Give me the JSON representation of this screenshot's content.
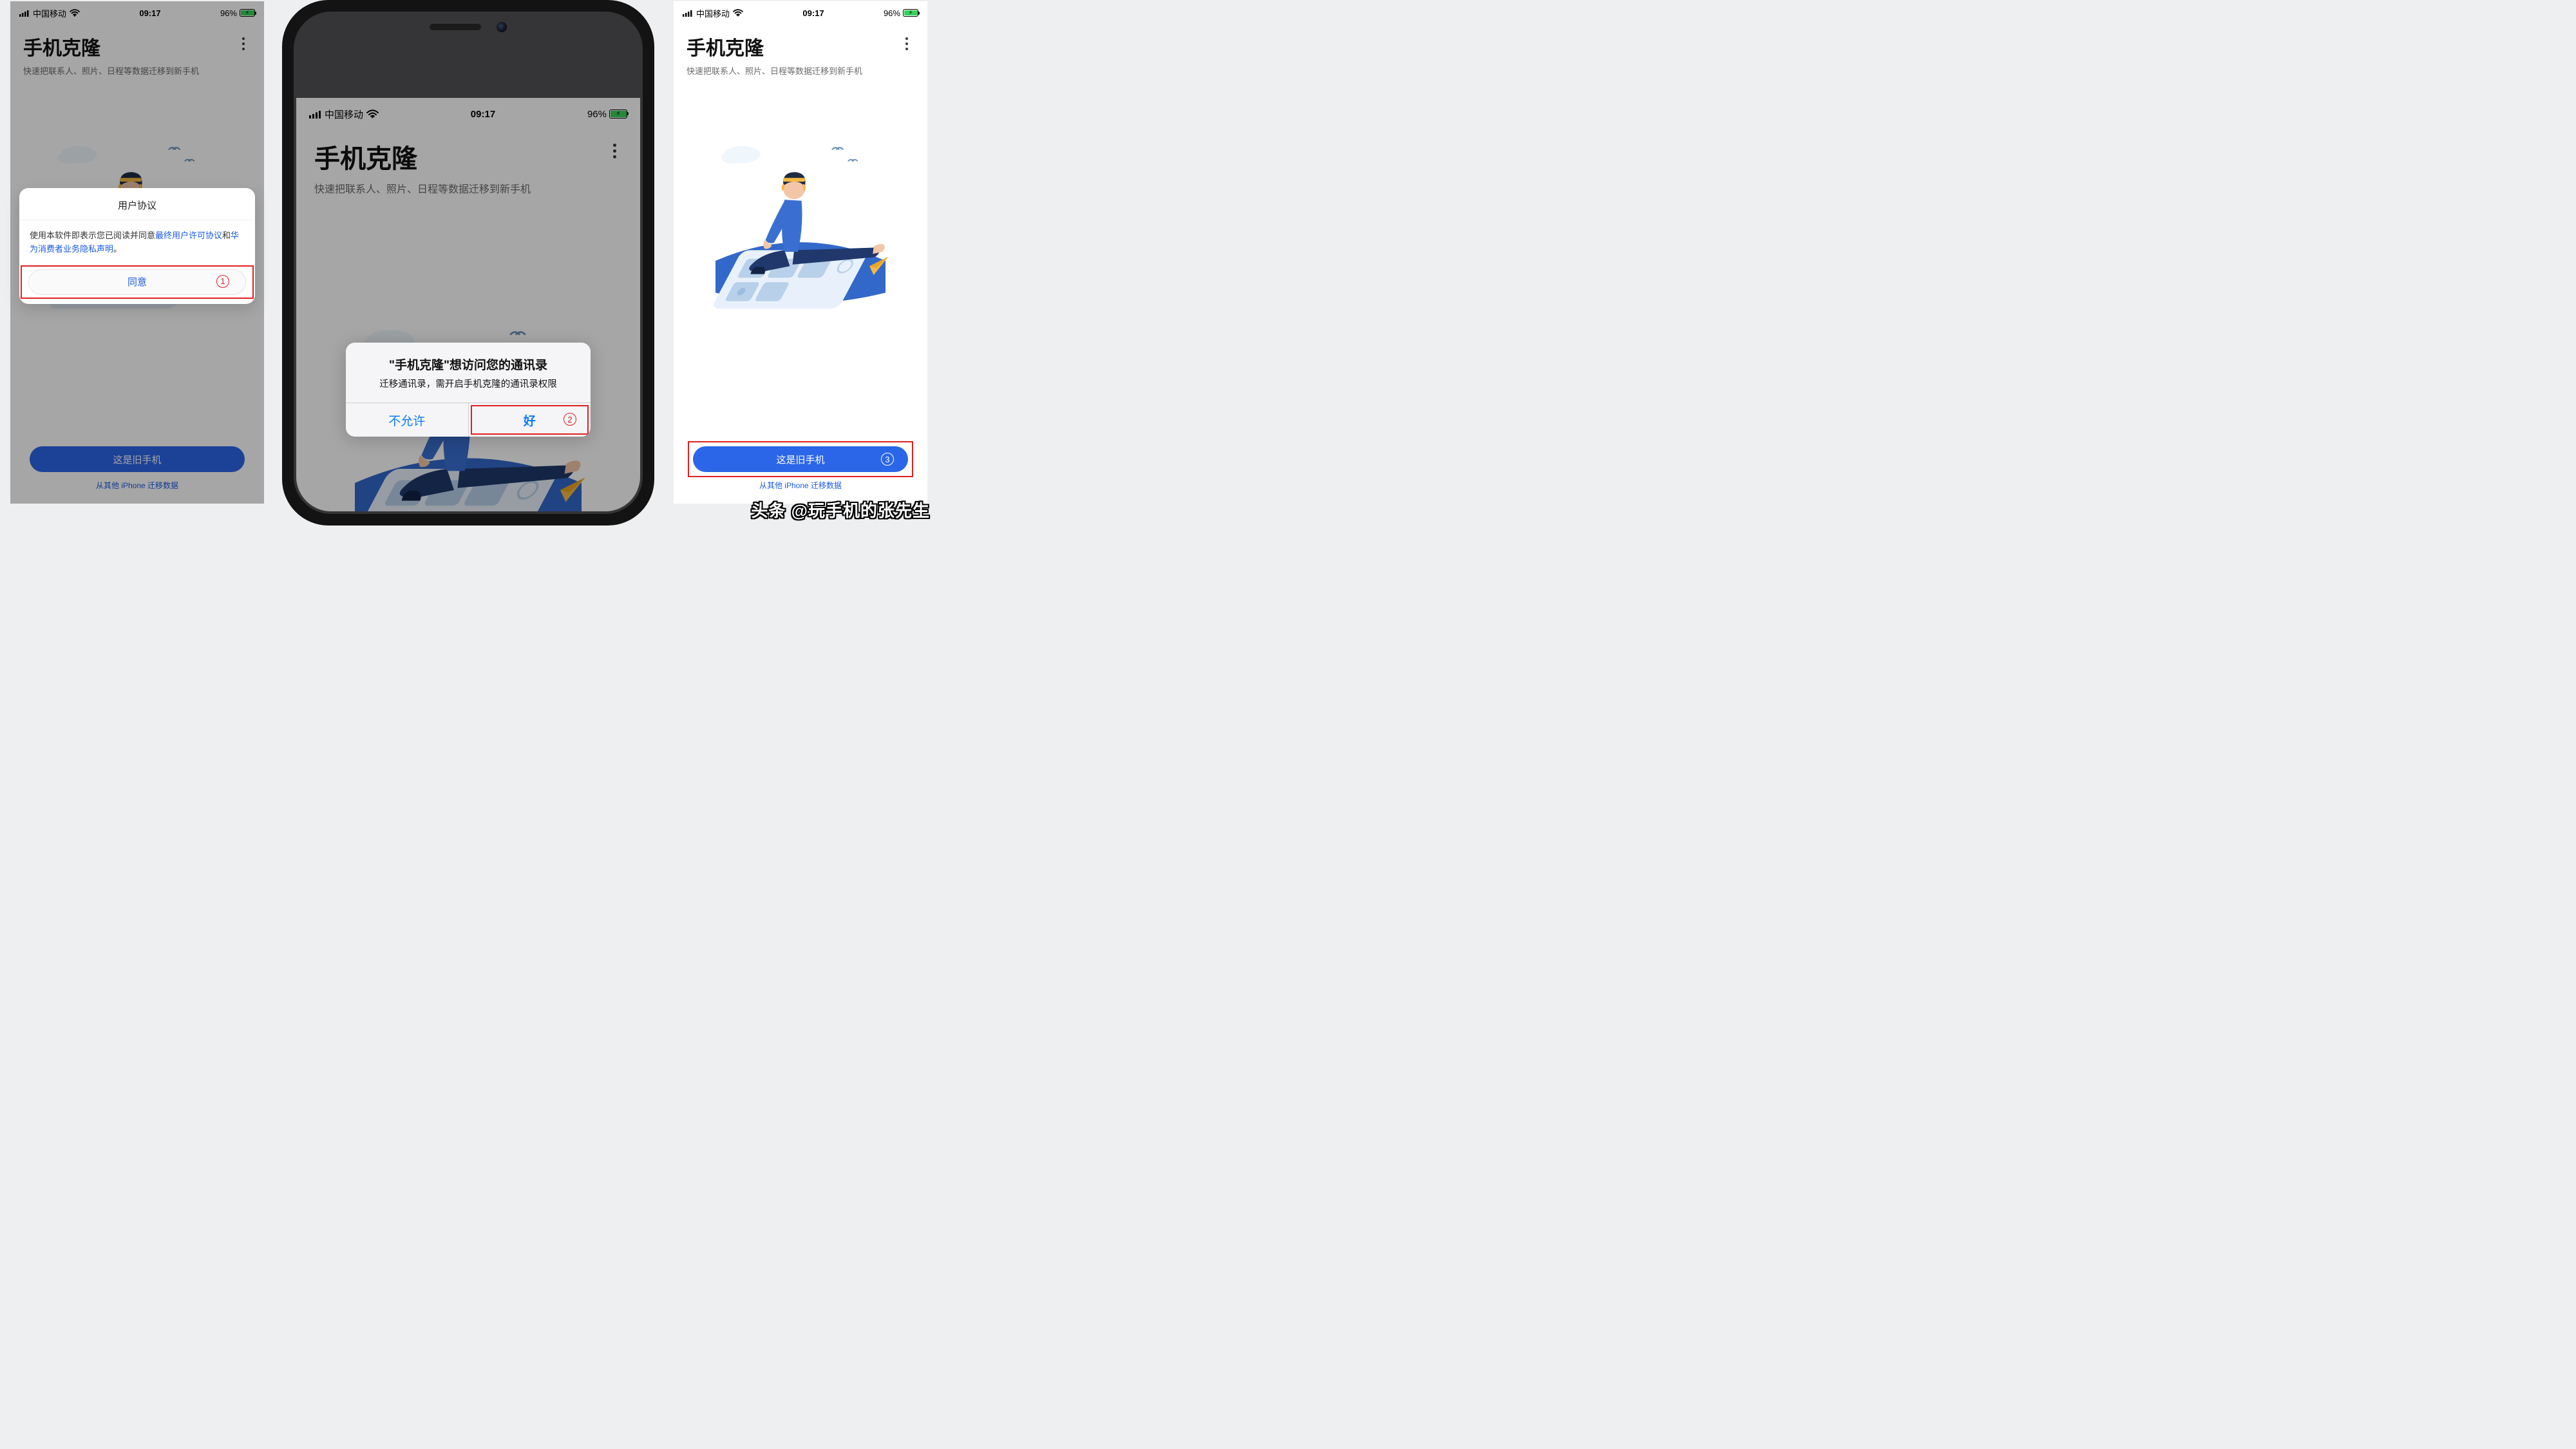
{
  "status": {
    "carrier": "中国移动",
    "time": "09:17",
    "battery_pct": "96%"
  },
  "header": {
    "title": "手机克隆",
    "subtitle": "快速把联系人、照片、日程等数据迁移到新手机"
  },
  "bottom": {
    "primary": "这是旧手机",
    "link": "从其他 iPhone 迁移数据"
  },
  "panel1": {
    "sheet_title": "用户协议",
    "sheet_text_1": "使用本软件即表示您已阅读并同意",
    "sheet_link_1": "最终用户许可协议",
    "sheet_text_2": "和",
    "sheet_link_2": "华为消费者业务隐私声明",
    "sheet_text_3": "。",
    "agree": "同意",
    "anno": "1"
  },
  "panel2": {
    "alert_title": "\"手机克隆\"想访问您的通讯录",
    "alert_msg": "迁移通讯录，需开启手机克隆的通讯录权限",
    "deny": "不允许",
    "allow": "好",
    "anno": "2"
  },
  "panel3": {
    "anno": "3"
  },
  "watermark": "头条 @玩手机的张先生"
}
